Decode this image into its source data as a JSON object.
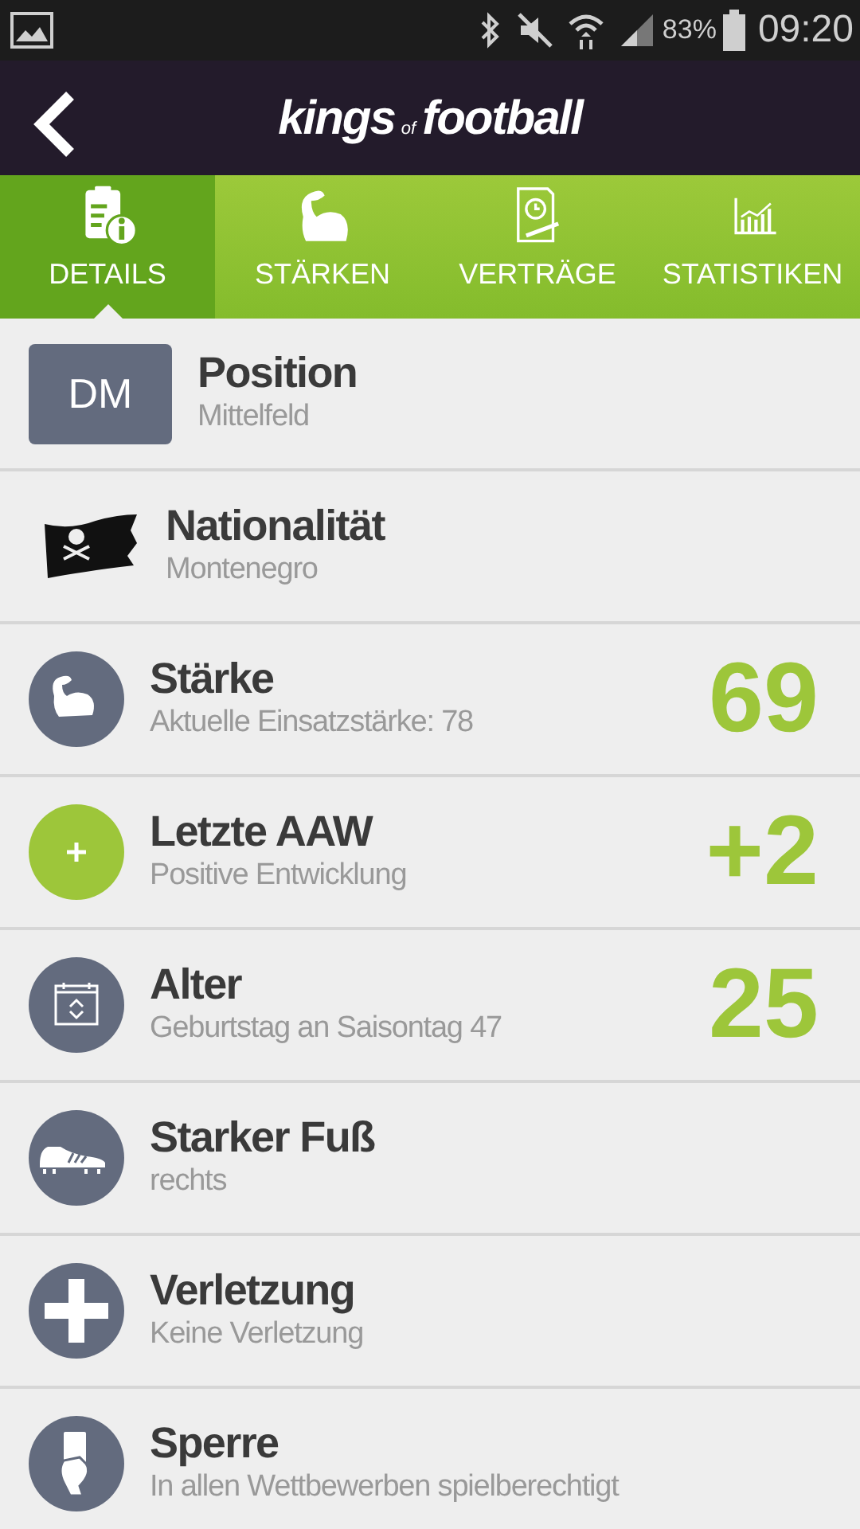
{
  "status_bar": {
    "battery": "83%",
    "time": "09:20"
  },
  "header": {
    "logo": [
      "kings",
      "of",
      "football"
    ]
  },
  "tabs": [
    {
      "label": "DETAILS",
      "selected": true
    },
    {
      "label": "STÄRKEN",
      "selected": false
    },
    {
      "label": "VERTRÄGE",
      "selected": false
    },
    {
      "label": "STATISTIKEN",
      "selected": false
    }
  ],
  "rows": [
    {
      "kind": "badge",
      "badge": "DM",
      "title": "Position",
      "subtitle": "Mittelfeld",
      "color": "#636b7e"
    },
    {
      "kind": "flag",
      "title": "Nationalität",
      "subtitle": "Montenegro"
    },
    {
      "kind": "icon",
      "title": "Stärke",
      "subtitle": "Aktuelle Einsatzstärke: 78",
      "value": "69",
      "color": "#636b7e"
    },
    {
      "kind": "icon",
      "title": "Letzte AAW",
      "subtitle": "Positive Entwicklung",
      "value": "+2",
      "color": "#9dc63a"
    },
    {
      "kind": "icon",
      "title": "Alter",
      "subtitle": "Geburtstag an Saisontag 47",
      "value": "25",
      "color": "#636b7e"
    },
    {
      "kind": "icon",
      "title": "Starker Fuß",
      "subtitle": "rechts",
      "color": "#636b7e"
    },
    {
      "kind": "icon",
      "title": "Verletzung",
      "subtitle": "Keine Verletzung",
      "color": "#636b7e"
    },
    {
      "kind": "icon",
      "title": "Sperre",
      "subtitle": "In allen Wettbewerben spielberechtigt",
      "color": "#636b7e"
    }
  ]
}
